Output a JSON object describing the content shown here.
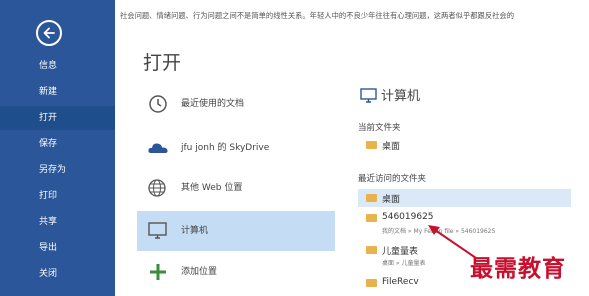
{
  "top_text": "社会问题、情绪问题、行为问题之间不是简单的线性关系。年轻人中的不良少年往往有心理问题，这两者似乎都跟反社会的",
  "sidebar": {
    "back_icon": "back-arrow-icon",
    "items": [
      {
        "label": "信息"
      },
      {
        "label": "新建"
      },
      {
        "label": "打开",
        "active": true
      },
      {
        "label": "保存"
      },
      {
        "label": "另存为"
      },
      {
        "label": "打印"
      },
      {
        "label": "共享"
      },
      {
        "label": "导出"
      },
      {
        "label": "关闭"
      }
    ]
  },
  "page_title": "打开",
  "places": [
    {
      "label": "最近使用的文档",
      "icon": "clock-icon"
    },
    {
      "label": "jfu jonh 的 SkyDrive",
      "icon": "cloud-icon"
    },
    {
      "label": "其他 Web 位置",
      "icon": "globe-icon"
    },
    {
      "label": "计算机",
      "icon": "computer-icon",
      "active": true
    },
    {
      "label": "添加位置",
      "icon": "plus-icon"
    }
  ],
  "right_panel": {
    "title": "计算机",
    "current_folder_label": "当前文件夹",
    "current_folder": {
      "name": "桌面"
    },
    "recent_label": "最近访问的文件夹",
    "recent_folders": [
      {
        "name": "桌面",
        "path": ""
      },
      {
        "name": "546019625",
        "path": "我的文档 » My Fetion file » 546019625"
      },
      {
        "name": "儿童量表",
        "path": "桌面 » 儿童量表"
      },
      {
        "name": "FileRecv",
        "path": ""
      }
    ]
  },
  "watermark": "最需教育",
  "colors": {
    "sidebar": "#2b579a",
    "active_place": "#c5dcf5",
    "folder": "#e8b24c",
    "watermark": "#c8102e"
  }
}
